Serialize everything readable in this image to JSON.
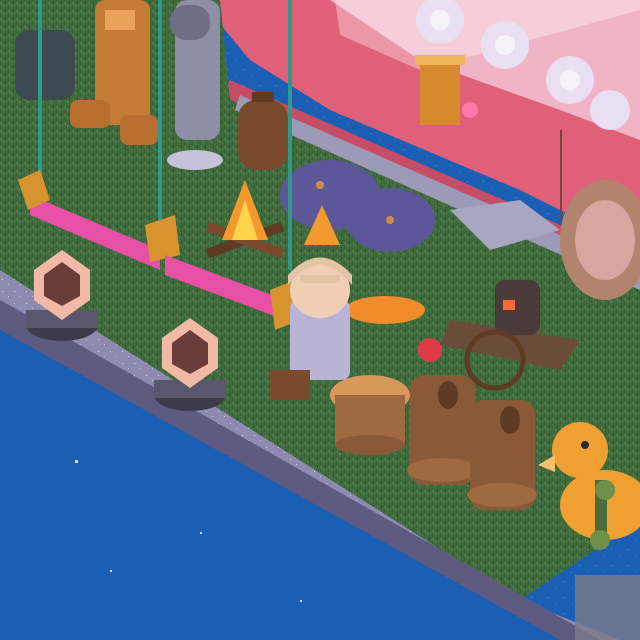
{
  "scene": {
    "type": "isometric pixel-art room",
    "colors": {
      "water": "#1a5fb4",
      "water_deep": "#0f4a9a",
      "lawn": "#3f6b3c",
      "lawn_dark": "#2f5530",
      "ledge": "#8a86a8",
      "ledge_top": "#b8b4d4",
      "pink_wall": "#e0607a",
      "pink_wall_dark": "#c74c66",
      "path": "#9d9ab8",
      "swing_cushion": "#e84fa6",
      "gold": "#d7932d",
      "wood": "#8a5a38",
      "wood_dark": "#5e3b22",
      "duck": "#f0a030",
      "orb": "#e9dff0",
      "lamp_glow": "#f2b9a6",
      "avatar_shirt": "#b9b3d6",
      "avatar_hair": "#e3c4a4"
    },
    "objects": [
      {
        "id": "swing-left",
        "icon": "swing-bench-icon"
      },
      {
        "id": "swing-right",
        "icon": "swing-bench-icon"
      },
      {
        "id": "campfire",
        "icon": "campfire-icon"
      },
      {
        "id": "kettle",
        "icon": "kettle-icon"
      },
      {
        "id": "blanket-pile",
        "icon": "blanket-icon"
      },
      {
        "id": "lantern-left",
        "icon": "geo-lamp-icon"
      },
      {
        "id": "lantern-right",
        "icon": "geo-lamp-icon"
      },
      {
        "id": "avatar",
        "icon": "avatar-icon"
      },
      {
        "id": "stump-table",
        "icon": "tree-stump-icon"
      },
      {
        "id": "stump-chair-1",
        "icon": "stump-chair-icon"
      },
      {
        "id": "stump-chair-2",
        "icon": "stump-chair-icon"
      },
      {
        "id": "roast-cart",
        "icon": "chestnut-cart-icon"
      },
      {
        "id": "rubber-duck",
        "icon": "duck-icon"
      },
      {
        "id": "statue",
        "icon": "statue-icon"
      },
      {
        "id": "disco-orbs",
        "icon": "disco-ball-icon"
      },
      {
        "id": "hanging-chair",
        "icon": "hanging-chair-icon"
      },
      {
        "id": "plant-stand",
        "icon": "plant-icon"
      }
    ]
  }
}
